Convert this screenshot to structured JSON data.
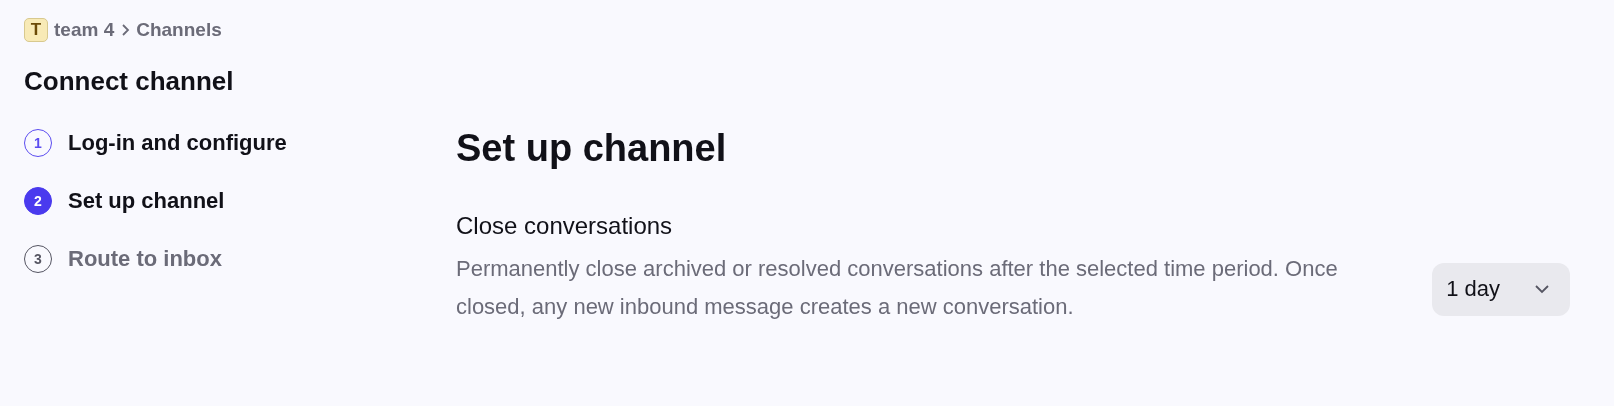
{
  "breadcrumb": {
    "avatar": "T",
    "items": [
      {
        "label": "team 4"
      },
      {
        "label": "Channels"
      }
    ]
  },
  "page_title": "Connect channel",
  "steps": [
    {
      "number": "1",
      "label": "Log-in and configure",
      "kind": "done",
      "selected": false
    },
    {
      "number": "2",
      "label": "Set up channel",
      "kind": "done",
      "selected": true
    },
    {
      "number": "3",
      "label": "Route to inbox",
      "kind": "upcoming",
      "selected": false
    }
  ],
  "section": {
    "title": "Set up channel",
    "setting": {
      "label": "Close conversations",
      "description": "Permanently close archived or resolved conversations after the selected time period. Once closed, any new inbound message creates a new conversation.",
      "value": "1 day"
    }
  }
}
